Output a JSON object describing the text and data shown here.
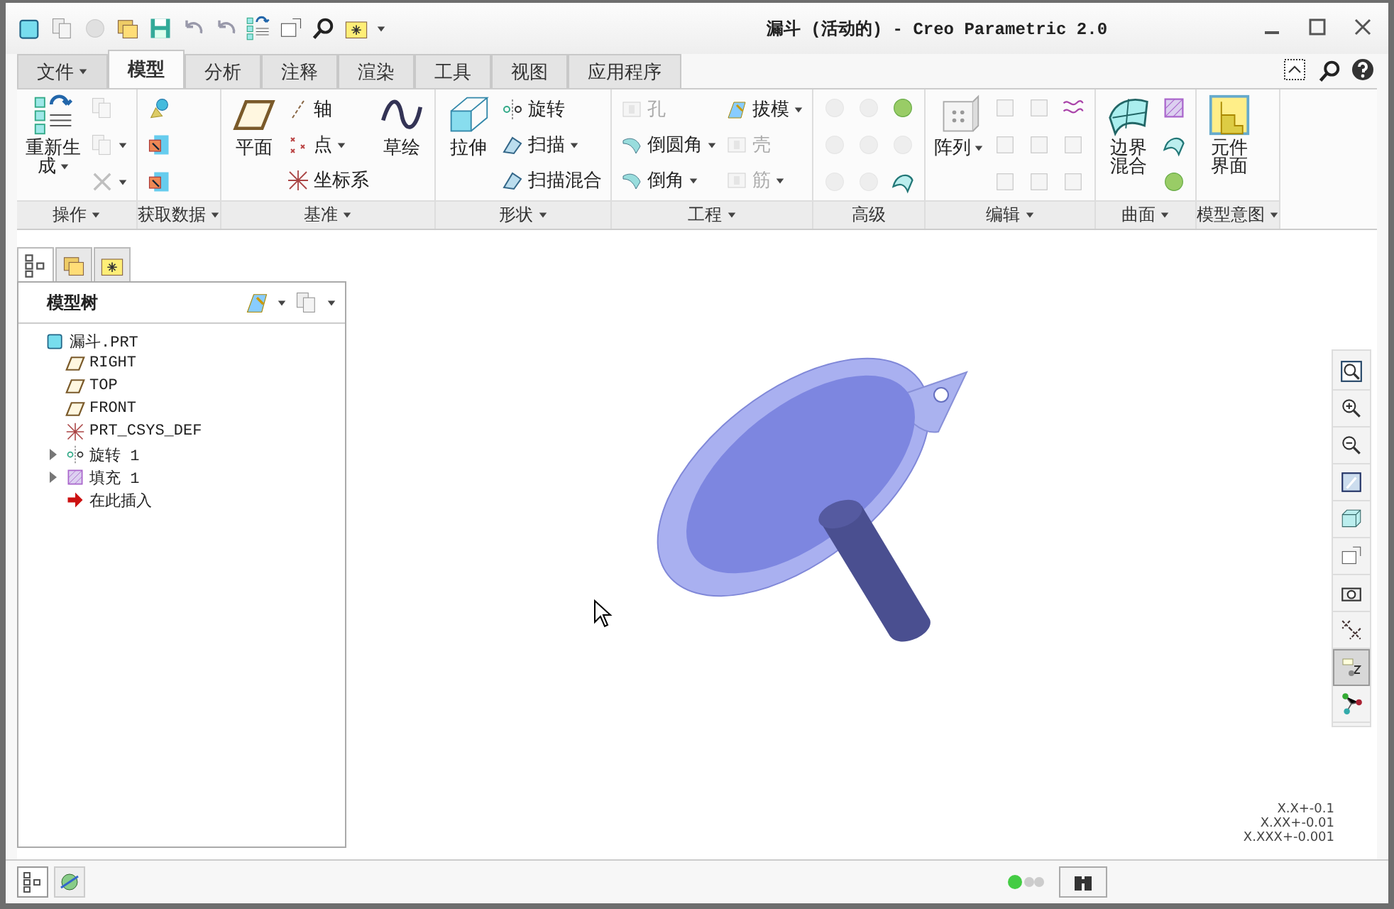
{
  "window": {
    "title": "漏斗 (活动的) - Creo Parametric 2.0"
  },
  "tabs": [
    {
      "label": "文件",
      "kind": "menu",
      "selected": false
    },
    {
      "label": "模型",
      "kind": "tab",
      "selected": true
    },
    {
      "label": "分析",
      "kind": "tab",
      "selected": false
    },
    {
      "label": "注释",
      "kind": "tab",
      "selected": false
    },
    {
      "label": "渲染",
      "kind": "tab",
      "selected": false
    },
    {
      "label": "工具",
      "kind": "tab",
      "selected": false
    },
    {
      "label": "视图",
      "kind": "tab",
      "selected": false
    },
    {
      "label": "应用程序",
      "kind": "tab",
      "selected": false
    }
  ],
  "ribbon_groups": [
    {
      "label": "操作",
      "dropdown": true,
      "columns": [
        [
          {
            "kind": "large",
            "lines": [
              "重新生",
              "成"
            ],
            "disabled": false,
            "dropdown": true
          }
        ],
        [
          {
            "kind": "icon",
            "disabled": true,
            "dropdown": false
          },
          {
            "kind": "icon",
            "disabled": true,
            "dropdown": true
          },
          {
            "kind": "icon",
            "disabled": true,
            "dropdown": true
          }
        ]
      ]
    },
    {
      "label": "获取数据",
      "dropdown": true,
      "columns": [
        [
          {
            "kind": "icon",
            "disabled": false,
            "dropdown": false
          },
          {
            "kind": "icon",
            "disabled": false,
            "dropdown": false
          },
          {
            "kind": "icon",
            "disabled": false,
            "dropdown": false
          }
        ]
      ]
    },
    {
      "label": "基准",
      "dropdown": true,
      "columns": [
        [
          {
            "kind": "large",
            "lines": [
              "平面"
            ],
            "disabled": false,
            "dropdown": false
          }
        ],
        [
          {
            "kind": "small",
            "label": "轴",
            "disabled": false,
            "dropdown": false
          },
          {
            "kind": "small",
            "label": "点",
            "disabled": false,
            "dropdown": true
          },
          {
            "kind": "small",
            "label": "坐标系",
            "disabled": false,
            "dropdown": false
          }
        ],
        [
          {
            "kind": "large",
            "lines": [
              "草绘"
            ],
            "disabled": false,
            "dropdown": false
          }
        ]
      ]
    },
    {
      "label": "形状",
      "dropdown": true,
      "columns": [
        [
          {
            "kind": "large",
            "lines": [
              "拉伸"
            ],
            "disabled": false,
            "dropdown": false
          }
        ],
        [
          {
            "kind": "small",
            "label": "旋转",
            "disabled": false,
            "dropdown": false
          },
          {
            "kind": "small",
            "label": "扫描",
            "disabled": false,
            "dropdown": true
          },
          {
            "kind": "small",
            "label": "扫描混合",
            "disabled": false,
            "dropdown": false
          }
        ]
      ]
    },
    {
      "label": "工程",
      "dropdown": true,
      "columns": [
        [
          {
            "kind": "small",
            "label": "孔",
            "disabled": true,
            "dropdown": false
          },
          {
            "kind": "small",
            "label": "倒圆角",
            "disabled": false,
            "dropdown": true
          },
          {
            "kind": "small",
            "label": "倒角",
            "disabled": false,
            "dropdown": true
          }
        ],
        [
          {
            "kind": "small",
            "label": "拔模",
            "disabled": false,
            "dropdown": true
          },
          {
            "kind": "small",
            "label": "壳",
            "disabled": true,
            "dropdown": false
          },
          {
            "kind": "small",
            "label": "筋",
            "disabled": true,
            "dropdown": true
          }
        ]
      ]
    },
    {
      "label": "高级",
      "dropdown": false,
      "columns": [
        [
          {
            "kind": "icon",
            "disabled": true,
            "dropdown": false
          },
          {
            "kind": "icon",
            "disabled": true,
            "dropdown": false
          },
          {
            "kind": "icon",
            "disabled": true,
            "dropdown": false
          }
        ],
        [
          {
            "kind": "icon",
            "disabled": true,
            "dropdown": false
          },
          {
            "kind": "icon",
            "disabled": true,
            "dropdown": false
          },
          {
            "kind": "icon",
            "disabled": true,
            "dropdown": false
          }
        ],
        [
          {
            "kind": "icon",
            "disabled": false,
            "dropdown": false
          },
          {
            "kind": "icon",
            "disabled": true,
            "dropdown": false
          },
          {
            "kind": "icon",
            "disabled": false,
            "dropdown": false
          }
        ]
      ]
    },
    {
      "label": "编辑",
      "dropdown": true,
      "columns": [
        [
          {
            "kind": "large",
            "lines": [
              "阵列"
            ],
            "disabled": false,
            "dropdown": true
          }
        ],
        [
          {
            "kind": "icon",
            "disabled": true,
            "dropdown": false
          },
          {
            "kind": "icon",
            "disabled": true,
            "dropdown": false
          },
          {
            "kind": "icon",
            "disabled": true,
            "dropdown": false
          }
        ],
        [
          {
            "kind": "icon",
            "disabled": true,
            "dropdown": false
          },
          {
            "kind": "icon",
            "disabled": true,
            "dropdown": false
          },
          {
            "kind": "icon",
            "disabled": true,
            "dropdown": false
          }
        ],
        [
          {
            "kind": "icon",
            "disabled": false,
            "dropdown": false
          },
          {
            "kind": "icon",
            "disabled": true,
            "dropdown": false
          },
          {
            "kind": "icon",
            "disabled": true,
            "dropdown": false
          }
        ]
      ]
    },
    {
      "label": "曲面",
      "dropdown": true,
      "columns": [
        [
          {
            "kind": "large",
            "lines": [
              "边界",
              "混合"
            ],
            "disabled": false,
            "dropdown": false
          }
        ],
        [
          {
            "kind": "icon",
            "disabled": false,
            "dropdown": false
          },
          {
            "kind": "icon",
            "disabled": false,
            "dropdown": false
          },
          {
            "kind": "icon",
            "disabled": false,
            "dropdown": false
          }
        ]
      ]
    },
    {
      "label": "模型意图",
      "dropdown": true,
      "columns": [
        [
          {
            "kind": "large",
            "lines": [
              "元件",
              "界面"
            ],
            "disabled": false,
            "dropdown": false
          }
        ]
      ]
    }
  ],
  "panel_tabs": [
    {
      "selected": true
    },
    {
      "selected": false
    },
    {
      "selected": false
    }
  ],
  "model_tree": {
    "title": "模型树",
    "items": [
      {
        "label": "漏斗.PRT",
        "kind": "part",
        "children": [
          {
            "label": "RIGHT",
            "kind": "plane"
          },
          {
            "label": "TOP",
            "kind": "plane"
          },
          {
            "label": "FRONT",
            "kind": "plane"
          },
          {
            "label": "PRT_CSYS_DEF",
            "kind": "csys"
          },
          {
            "label": "旋转 1",
            "kind": "revolve",
            "expanded": false
          },
          {
            "label": "填充 1",
            "kind": "fill",
            "expanded": false
          },
          {
            "label": "在此插入",
            "kind": "insert"
          }
        ]
      }
    ]
  },
  "view_toolbar": [
    {
      "selected": false
    },
    {
      "selected": false
    },
    {
      "selected": false
    },
    {
      "selected": false
    },
    {
      "selected": false
    },
    {
      "selected": false
    },
    {
      "selected": false
    },
    {
      "selected": false
    },
    {
      "selected": true
    },
    {
      "selected": false
    }
  ],
  "tolerances": [
    "X.X+-0.1",
    "X.XX+-0.01",
    "X.XXX+-0.001"
  ],
  "status_bar": {
    "buttons": [
      {
        "selected": true
      },
      {
        "selected": false
      }
    ]
  }
}
